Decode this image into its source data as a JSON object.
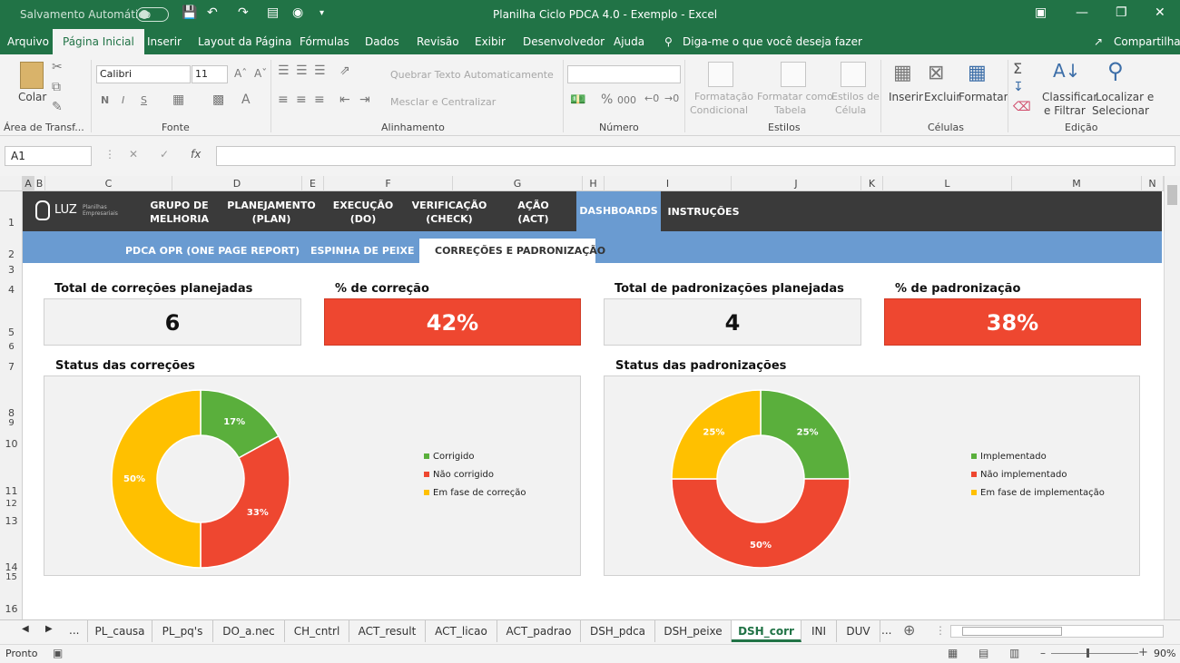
{
  "titlebar": {
    "autosave_label": "Salvamento Automático",
    "title": "Planilha Ciclo PDCA 4.0 - Exemplo  -  Excel"
  },
  "menu": {
    "items": [
      "Arquivo",
      "Página Inicial",
      "Inserir",
      "Layout da Página",
      "Fórmulas",
      "Dados",
      "Revisão",
      "Exibir",
      "Desenvolvedor",
      "Ajuda"
    ],
    "tell_me": "Diga-me o que você deseja fazer",
    "share": "Compartilhar"
  },
  "ribbon": {
    "paste": "Colar",
    "group_clipboard": "Área de Transf...",
    "font_name": "Calibri",
    "font_size": "11",
    "bold": "N",
    "italic": "I",
    "underline": "S",
    "group_font": "Fonte",
    "wrap_text": "Quebrar Texto Automaticamente",
    "merge_center": "Mesclar e Centralizar",
    "group_alignment": "Alinhamento",
    "number_format": "",
    "group_number": "Número",
    "cond_format_1": "Formatação",
    "cond_format_2": "Condicional",
    "format_table_1": "Formatar como",
    "format_table_2": "Tabela",
    "cell_styles_1": "Estilos de",
    "cell_styles_2": "Célula",
    "group_styles": "Estilos",
    "insert": "Inserir",
    "delete": "Excluir",
    "format": "Formatar",
    "group_cells": "Células",
    "sort_filter_1": "Classificar",
    "sort_filter_2": "e Filtrar",
    "find_select_1": "Localizar e",
    "find_select_2": "Selecionar",
    "group_editing": "Edição"
  },
  "formula_bar": {
    "name_box": "A1",
    "fx": "fx",
    "value": ""
  },
  "columns": [
    "A",
    "B",
    "C",
    "D",
    "E",
    "F",
    "G",
    "H",
    "I",
    "J",
    "K",
    "L",
    "M",
    "N"
  ],
  "rows": [
    "1",
    "2",
    "3",
    "4",
    "5",
    "6",
    "7",
    "8",
    "9",
    "10",
    "11",
    "12",
    "13",
    "14",
    "15",
    "16"
  ],
  "sheet": {
    "logo_text": "LUZ",
    "logo_sub": "Planilhas Empresariais",
    "nav1": [
      {
        "l1": "GRUPO DE",
        "l2": "MELHORIA"
      },
      {
        "l1": "PLANEJAMENTO",
        "l2": "(PLAN)"
      },
      {
        "l1": "EXECUÇÃO",
        "l2": "(DO)"
      },
      {
        "l1": "VERIFICAÇÃO",
        "l2": "(CHECK)"
      },
      {
        "l1": "AÇÃO",
        "l2": "(ACT)"
      },
      {
        "l1": "DASHBOARDS",
        "l2": ""
      },
      {
        "l1": "INSTRUÇÕES",
        "l2": ""
      }
    ],
    "nav2": [
      "PDCA OPR (ONE PAGE REPORT)",
      "ESPINHA DE PEIXE",
      "CORREÇÕES E PADRONIZAÇÃO"
    ],
    "kpi": [
      {
        "label": "Total de correções planejadas",
        "value": "6"
      },
      {
        "label": "% de correção",
        "value": "42%"
      },
      {
        "label": "Total de padronizações planejadas",
        "value": "4"
      },
      {
        "label": "% de padronização",
        "value": "38%"
      }
    ],
    "chart_title_left": "Status das correções",
    "chart_title_right": "Status das padronizações"
  },
  "chart_data": [
    {
      "type": "pie",
      "title": "Status das correções",
      "categories": [
        "Corrigido",
        "Não corrigido",
        "Em fase de correção"
      ],
      "values": [
        17,
        33,
        50
      ],
      "labels": [
        "17%",
        "33%",
        "50%"
      ],
      "colors": [
        "#5aaf3c",
        "#ee4730",
        "#ffc000"
      ],
      "legend": "right"
    },
    {
      "type": "pie",
      "title": "Status das padronizações",
      "categories": [
        "Implementado",
        "Não implementado",
        "Em fase de implementação"
      ],
      "values": [
        25,
        50,
        25
      ],
      "labels": [
        "25%",
        "50%",
        "25%"
      ],
      "colors": [
        "#5aaf3c",
        "#ee4730",
        "#ffc000"
      ],
      "legend": "right"
    }
  ],
  "tabs": {
    "ellipsis": "...",
    "items": [
      "PL_causa",
      "PL_pq's",
      "DO_a.nec",
      "CH_cntrl",
      "ACT_result",
      "ACT_licao",
      "ACT_padrao",
      "DSH_pdca",
      "DSH_peixe",
      "DSH_corr",
      "INI",
      "DUV"
    ],
    "active": "DSH_corr"
  },
  "status": {
    "ready": "Pronto",
    "zoom": "90%"
  },
  "colors": {
    "excel_green": "#217346",
    "nav_dark": "#3a3a3a",
    "nav_blue": "#6a9bd1",
    "kpi_red": "#ee4730"
  }
}
